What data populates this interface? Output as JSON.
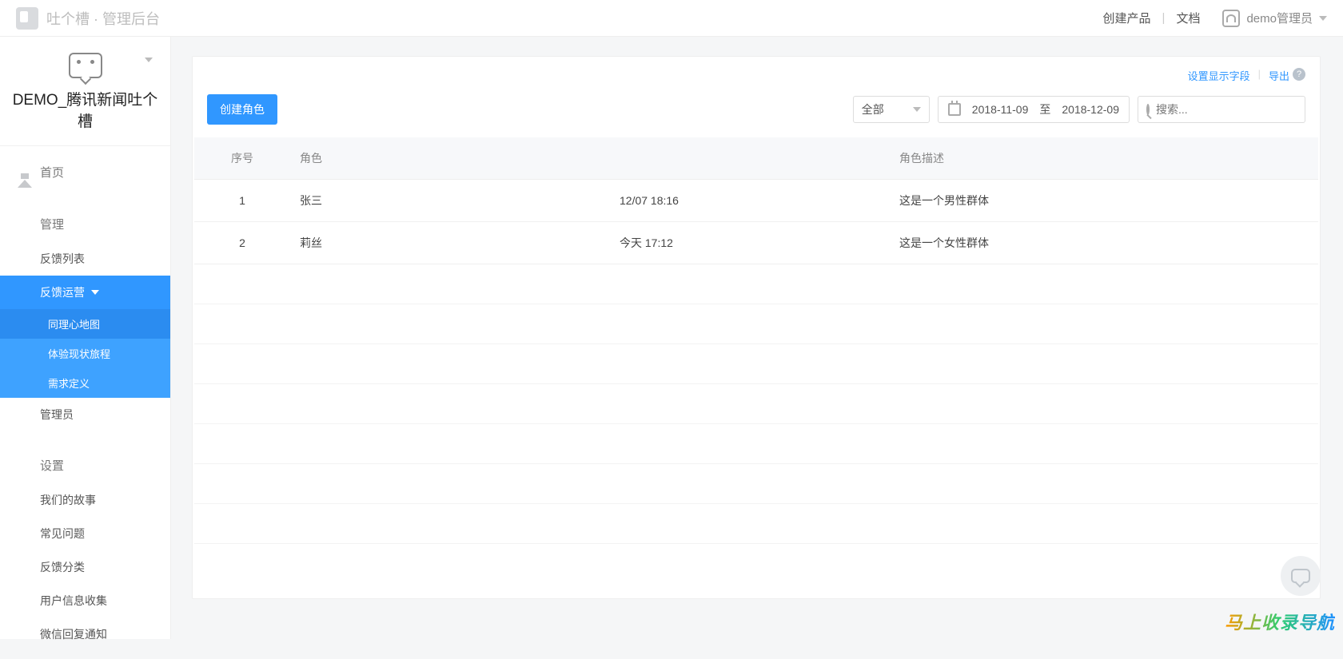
{
  "header": {
    "brand": "吐个槽 · 管理后台",
    "create_product": "创建产品",
    "docs": "文档",
    "username": "demo管理员"
  },
  "sidebar": {
    "project_name": "DEMO_腾讯新闻吐个槽",
    "home": "首页",
    "manage": "管理",
    "manage_items": {
      "feedback_list": "反馈列表",
      "feedback_ops": "反馈运营",
      "sub": {
        "empathy_map": "同理心地图",
        "experience_journey": "体验现状旅程",
        "requirement_def": "需求定义"
      },
      "admin": "管理员"
    },
    "settings": "设置",
    "settings_items": {
      "our_story": "我们的故事",
      "faq": "常见问题",
      "feedback_category": "反馈分类",
      "user_info_collect": "用户信息收集",
      "wechat_reply_notify": "微信回复通知"
    }
  },
  "panel": {
    "set_display_fields": "设置显示字段",
    "export": "导出",
    "create_role": "创建角色",
    "filter_all": "全部",
    "date_from": "2018-11-09",
    "date_to_label": "至",
    "date_to": "2018-12-09",
    "search_placeholder": "搜索..."
  },
  "table": {
    "columns": {
      "index": "序号",
      "role": "角色",
      "desc": "角色描述"
    },
    "rows": [
      {
        "index": "1",
        "role": "张三",
        "time": "12/07 18:16",
        "desc": "这是一个男性群体"
      },
      {
        "index": "2",
        "role": "莉丝",
        "time": "今天 17:12",
        "desc": "这是一个女性群体"
      }
    ]
  },
  "watermark": "马上收录导航"
}
